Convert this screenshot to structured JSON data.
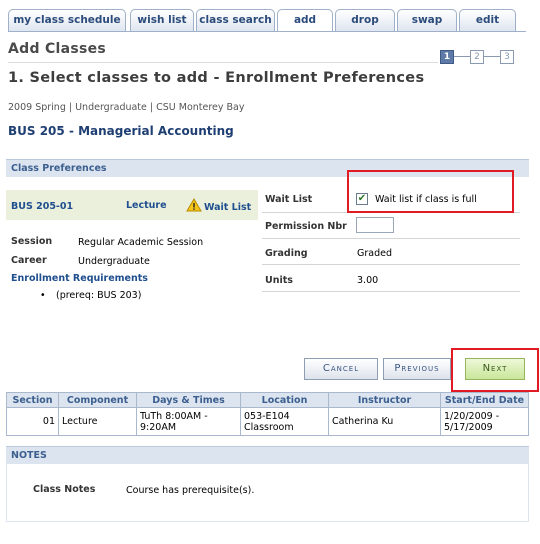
{
  "tabs": [
    {
      "label": "my class schedule"
    },
    {
      "label": "wish list"
    },
    {
      "label": "class search"
    },
    {
      "label": "add"
    },
    {
      "label": "drop"
    },
    {
      "label": "swap"
    },
    {
      "label": "edit"
    }
  ],
  "page_title": "Add Classes",
  "steps": [
    {
      "label": "1"
    },
    {
      "label": "2"
    },
    {
      "label": "3"
    }
  ],
  "step_heading": "1.  Select classes to add - Enrollment Preferences",
  "term_info": "2009 Spring | Undergraduate | CSU Monterey Bay",
  "course_title": "BUS  205 - Managerial Accounting",
  "class_preferences": {
    "header": "Class Preferences",
    "class_section": "BUS  205-01",
    "component": "Lecture",
    "wait_list_status": "Wait List",
    "session_label": "Session",
    "session_value": "Regular Academic Session",
    "career_label": "Career",
    "career_value": "Undergraduate",
    "enrollment_req_label": "Enrollment Requirements",
    "enrollment_req_item": "(prereq: BUS 203)"
  },
  "preferences": {
    "wait_list_label": "Wait List",
    "wait_list_checkbox_label": "Wait list if class is full",
    "wait_list_checked": true,
    "permission_label": "Permission Nbr",
    "permission_value": "",
    "grading_label": "Grading",
    "grading_value": "Graded",
    "units_label": "Units",
    "units_value": "3.00"
  },
  "buttons": {
    "cancel": "Cancel",
    "previous": "Previous",
    "next": "Next"
  },
  "class_table": {
    "headers": [
      "Section",
      "Component",
      "Days & Times",
      "Location",
      "Instructor",
      "Start/End Date"
    ],
    "rows": [
      {
        "section": "01",
        "component": "Lecture",
        "days_times": "TuTh 8:00AM - 9:20AM",
        "location": "053-E104 Classroom",
        "instructor": "Catherina Ku",
        "dates": "1/20/2009 - 5/17/2009"
      }
    ]
  },
  "notes": {
    "header": "NOTES",
    "class_notes_label": "Class Notes",
    "class_notes_value": "Course has prerequisite(s)."
  },
  "colors": {
    "accent_blue": "#1f4f8f",
    "header_bg": "#dbe4ef",
    "highlight_red": "#e01b24",
    "next_button_green": "#c9e69a"
  }
}
